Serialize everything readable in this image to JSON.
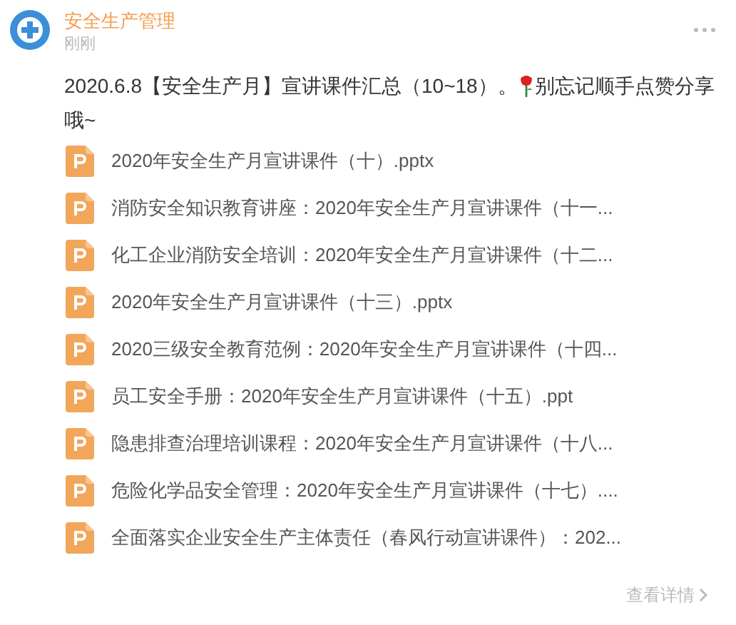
{
  "account": {
    "name": "安全生产管理",
    "time": "刚刚"
  },
  "post": {
    "text_before_icon": "2020.6.8【安全生产月】宣讲课件汇总（10~18）。",
    "text_after_icon": "别忘记顺手点赞分享",
    "text_wrapped": "哦~"
  },
  "attachments": [
    {
      "kind": "ppt",
      "title": "2020年安全生产月宣讲课件（十）.pptx"
    },
    {
      "kind": "ppt",
      "title": "消防安全知识教育讲座：2020年安全生产月宣讲课件（十一..."
    },
    {
      "kind": "ppt",
      "title": "化工企业消防安全培训：2020年安全生产月宣讲课件（十二..."
    },
    {
      "kind": "ppt",
      "title": "2020年安全生产月宣讲课件（十三）.pptx"
    },
    {
      "kind": "ppt",
      "title": "2020三级安全教育范例：2020年安全生产月宣讲课件（十四..."
    },
    {
      "kind": "ppt",
      "title": "员工安全手册：2020年安全生产月宣讲课件（十五）.ppt"
    },
    {
      "kind": "ppt",
      "title": "隐患排查治理培训课程：2020年安全生产月宣讲课件（十八..."
    },
    {
      "kind": "ppt",
      "title": "危险化学品安全管理：2020年安全生产月宣讲课件（十七）...."
    },
    {
      "kind": "ppt",
      "title": "全面落实企业安全生产主体责任（春风行动宣讲课件）：202..."
    }
  ],
  "footer": {
    "link": "查看详情"
  }
}
